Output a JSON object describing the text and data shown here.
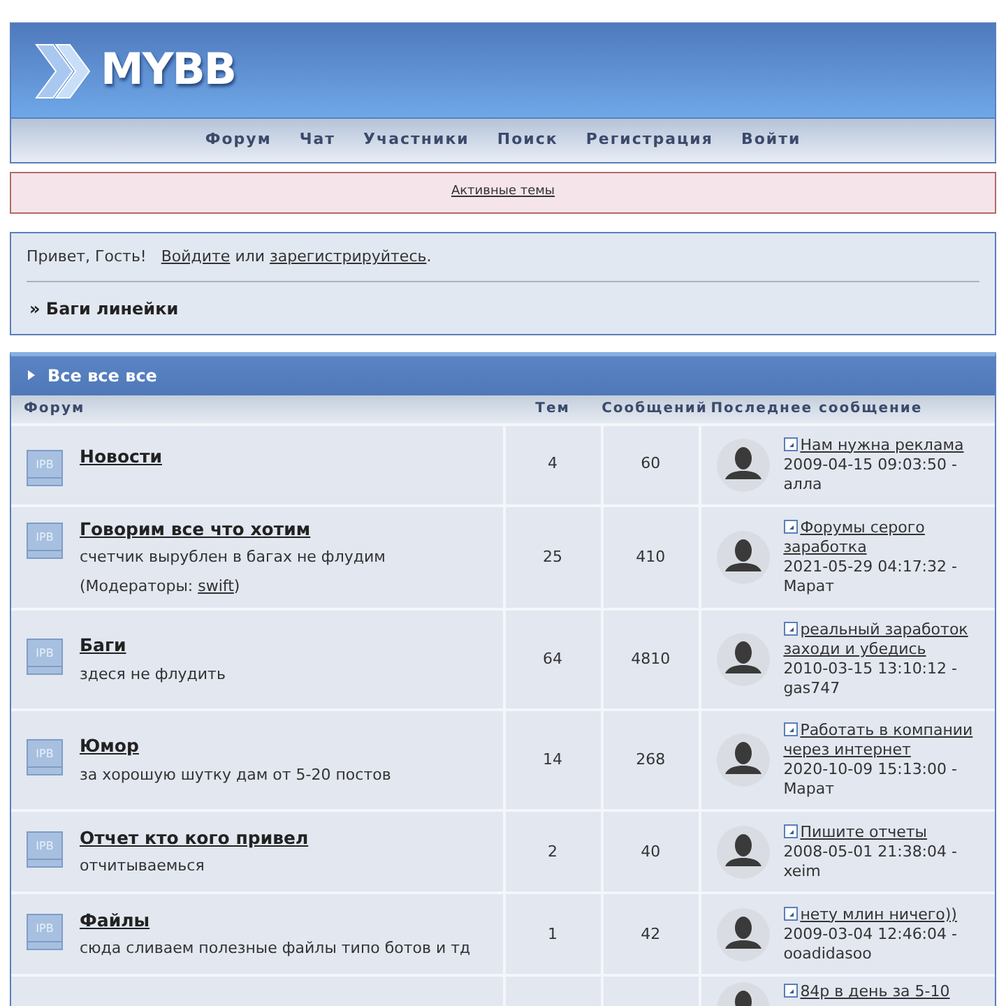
{
  "header": {
    "logo": "MYBB"
  },
  "nav": [
    "Форум",
    "Чат",
    "Участники",
    "Поиск",
    "Регистрация",
    "Войти"
  ],
  "notice": {
    "link": "Активные темы"
  },
  "welcome": {
    "greeting": "Привет, Гость!",
    "login_link": "Войдите",
    "joiner": "или",
    "register_link": "зарегистрируйтесь",
    "tail": "."
  },
  "breadcrumb": "» Баги линейки",
  "category": {
    "title": "Все все все",
    "columns": [
      "Форум",
      "Тем",
      "Сообщений",
      "Последнее сообщение"
    ],
    "forums": [
      {
        "icon": "IPB",
        "title": "Новости",
        "topics": "4",
        "posts": "60",
        "last_post": {
          "title": "Нам нужна реклама",
          "date": "2009-04-15 09:03:50 -",
          "author": "алла"
        }
      },
      {
        "icon": "IPB",
        "title": "Говорим все что хотим",
        "description": "счетчик вырублен в багах не флудим",
        "moderators_label": "(Модераторы:",
        "moderator": "swift",
        "moderators_end": ")",
        "topics": "25",
        "posts": "410",
        "last_post": {
          "title": "Форумы серого заработка",
          "date": "2021-05-29 04:17:32 -",
          "author": "Марат"
        }
      },
      {
        "icon": "IPB",
        "title": "Баги",
        "description": "здеся не флудить",
        "topics": "64",
        "posts": "4810",
        "last_post": {
          "title": "реальный заработок заходи и убедись",
          "date": "2010-03-15 13:10:12 -",
          "author": "gas747"
        }
      },
      {
        "icon": "IPB",
        "title": "Юмор",
        "description": "за хорошую шутку дам от 5-20 постов",
        "topics": "14",
        "posts": "268",
        "last_post": {
          "title": "Работать в компании через интернет",
          "date": "2020-10-09 15:13:00 -",
          "author": "Марат"
        }
      },
      {
        "icon": "IPB",
        "title": "Отчет кто кого привел",
        "description": "отчитываемься",
        "topics": "2",
        "posts": "40",
        "last_post": {
          "title": "Пишите отчеты",
          "date": "2008-05-01 21:38:04 -",
          "author": "xeim"
        }
      },
      {
        "icon": "IPB",
        "title": "Файлы",
        "description": "сюда сливаем полезные файлы типо ботов и тд",
        "topics": "1",
        "posts": "42",
        "last_post": {
          "title": "нету млин ничего))",
          "date": "2009-03-04 12:46:04 -",
          "author": "ooadidasoo"
        }
      },
      {
        "last_post": {
          "title": "84р в день за 5-10"
        }
      }
    ]
  }
}
